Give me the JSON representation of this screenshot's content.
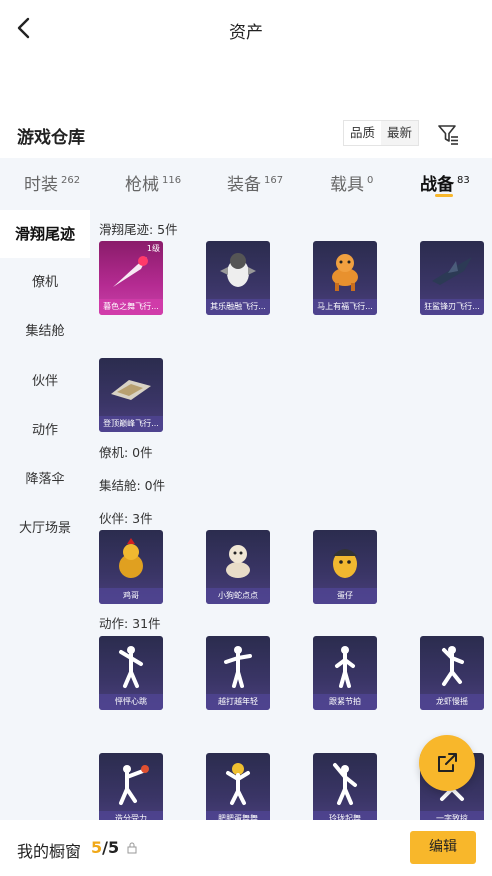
{
  "header": {
    "title": "资产"
  },
  "warehouse": {
    "title": "游戏仓库",
    "sort_options": [
      "品质",
      "最新"
    ]
  },
  "tabs": [
    {
      "label": "时装",
      "count": "262"
    },
    {
      "label": "枪械",
      "count": "116"
    },
    {
      "label": "装备",
      "count": "167"
    },
    {
      "label": "载具",
      "count": "0"
    },
    {
      "label": "战备",
      "count": "83"
    }
  ],
  "sidebar": [
    {
      "label": "滑翔尾迹"
    },
    {
      "label": "僚机"
    },
    {
      "label": "集结舱"
    },
    {
      "label": "伙伴"
    },
    {
      "label": "动作"
    },
    {
      "label": "降落伞"
    },
    {
      "label": "大厅场景"
    }
  ],
  "sections": {
    "glide": {
      "label": "滑翔尾迹: 5件",
      "items": [
        {
          "name": "暮色之舞飞行...",
          "level": "1级"
        },
        {
          "name": "其乐融融飞行..."
        },
        {
          "name": "马上有福飞行..."
        },
        {
          "name": "狂鲨锋刃飞行..."
        },
        {
          "name": "登顶巅峰飞行..."
        }
      ]
    },
    "wingman": {
      "label": "僚机: 0件"
    },
    "capsule": {
      "label": "集结舱: 0件"
    },
    "partner": {
      "label": "伙伴: 3件",
      "items": [
        {
          "name": "鸡哥"
        },
        {
          "name": "小狗蛇点点"
        },
        {
          "name": "蛋仔"
        }
      ]
    },
    "emote": {
      "label": "动作: 31件",
      "items": [
        {
          "name": "怦怦心跳"
        },
        {
          "name": "越打越年轻"
        },
        {
          "name": "跟紧节拍"
        },
        {
          "name": "龙虾慢摇"
        },
        {
          "name": "造分受力"
        },
        {
          "name": "肥肥蛋舞舞"
        },
        {
          "name": "玲珑起舞"
        },
        {
          "name": "一字致掠"
        }
      ]
    }
  },
  "bottom": {
    "label": "我的橱窗",
    "current": "5",
    "total": "/5",
    "edit_label": "编辑"
  },
  "colors": {
    "accent": "#f8b72b",
    "background": "#f3f6fa",
    "card": "#2b2c4e",
    "rare_card": "#b52b92"
  }
}
